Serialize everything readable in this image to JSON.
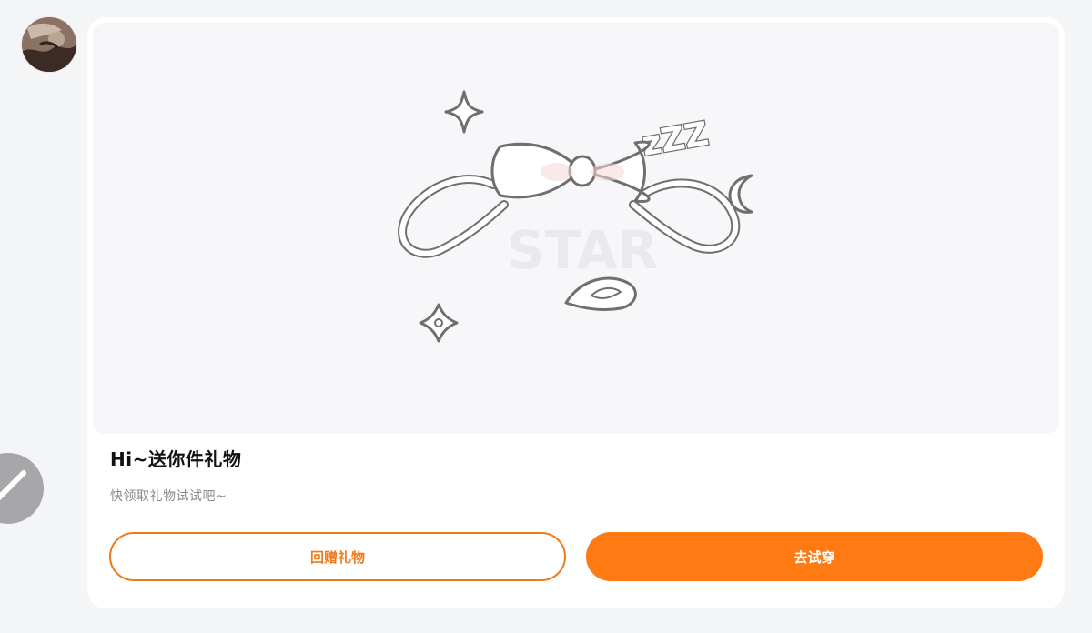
{
  "message": {
    "sender_avatar": "avatar",
    "side_action": "edit-icon"
  },
  "card": {
    "title": "Hi~送你件礼物",
    "subtitle": "快领取礼物试试吧~",
    "buttons": {
      "return_label": "回赠礼物",
      "try_label": "去试穿"
    }
  },
  "illustration": {
    "sleep_text": "zZZ",
    "watermark_text": "STAR"
  },
  "colors": {
    "accent": "#ff7a12",
    "outline_accent": "#f07a1a",
    "page_bg": "#f4f5f7",
    "card_bg": "#ffffff"
  }
}
